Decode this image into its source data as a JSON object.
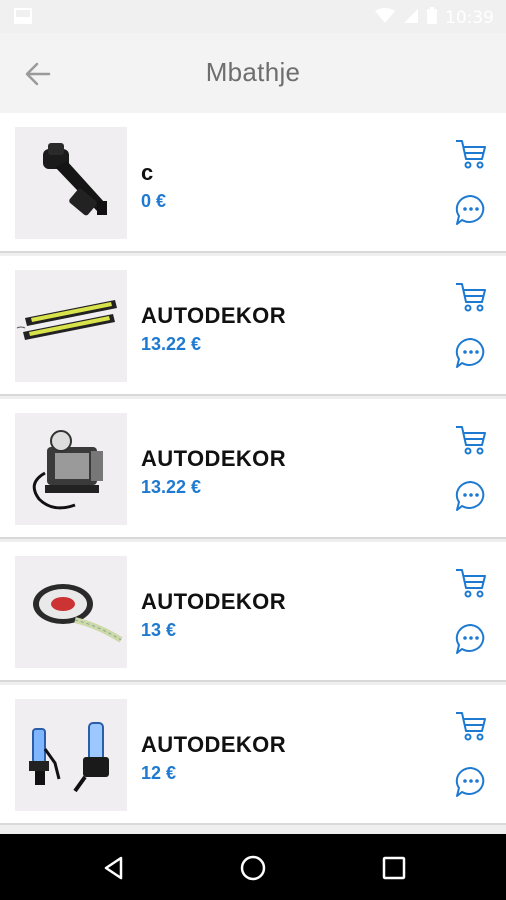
{
  "status_bar": {
    "time": "10:39"
  },
  "app_bar": {
    "title": "Mbathje"
  },
  "products": [
    {
      "name": "c",
      "price": "0 €",
      "image": "phone-holder"
    },
    {
      "name": "AUTODEKOR",
      "price": "13.22 €",
      "image": "led-strips"
    },
    {
      "name": "AUTODEKOR",
      "price": "13.22 €",
      "image": "air-compressor"
    },
    {
      "name": "AUTODEKOR",
      "price": "13 €",
      "image": "led-tape-reel"
    },
    {
      "name": "AUTODEKOR",
      "price": "12 €",
      "image": "headlight-bulbs"
    }
  ],
  "colors": {
    "accent": "#1e7ad1",
    "title": "#6e6e6e",
    "background": "#efefef"
  }
}
